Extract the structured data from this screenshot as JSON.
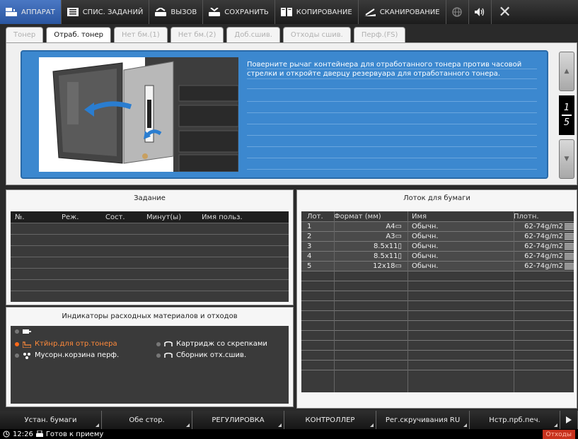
{
  "topbar": {
    "items": [
      {
        "label": "АППАРАТ",
        "icon": "machine-icon"
      },
      {
        "label": "СПИС. ЗАДАНИЙ",
        "icon": "job-list-icon"
      },
      {
        "label": "ВЫЗОВ",
        "icon": "recall-icon"
      },
      {
        "label": "СОХРАНИТЬ",
        "icon": "store-icon"
      },
      {
        "label": "КОПИРОВАНИЕ",
        "icon": "copy-icon"
      },
      {
        "label": "СКАНИРОВАНИЕ",
        "icon": "scan-icon"
      }
    ],
    "globe_icon": "globe-icon",
    "sound_icon": "speaker-icon",
    "close_label": "✕"
  },
  "tabs": [
    {
      "label": "Тонер",
      "active": false
    },
    {
      "label": "Отраб. тонер",
      "active": true
    },
    {
      "label": "Нет бм.(1)",
      "active": false
    },
    {
      "label": "Нет бм.(2)",
      "active": false
    },
    {
      "label": "Доб.сшив.",
      "active": false
    },
    {
      "label": "Отходы сшив.",
      "active": false
    },
    {
      "label": "Перф.(FS)",
      "active": false
    }
  ],
  "instruction": {
    "text": "Поверните рычаг контейнера для отработанного тонера против часовой стрелки и откройте дверцу резервуара для отработанного тонера.",
    "page_current": "1",
    "page_total": "5",
    "up_label": "▲",
    "down_label": "▼"
  },
  "job_panel": {
    "title": "Задание",
    "columns": [
      "№.",
      "Реж.",
      "Сост.",
      "Минут(ы)",
      "Имя польз."
    ]
  },
  "consumables": {
    "title": "Индикаторы расходных материалов и отходов",
    "items": [
      {
        "label": "",
        "active": false
      },
      {
        "label": "Ктйнр.для отр.тонера",
        "active": true
      },
      {
        "label": "Картридж со скрепками",
        "active": false
      },
      {
        "label": "Мусорн.корзина перф.",
        "active": false
      },
      {
        "label": "Сборник отх.сшив.",
        "active": false
      }
    ],
    "active_color": "#ff6a1a"
  },
  "tray_panel": {
    "title": "Лоток для бумаги",
    "columns": [
      "Лот.",
      "Формат (мм)",
      "Имя",
      "Плотн."
    ],
    "rows": [
      {
        "lot": "1",
        "format": "A4",
        "name": "Обычн.",
        "weight": "62-74g/m2"
      },
      {
        "lot": "2",
        "format": "A3",
        "name": "Обычн.",
        "weight": "62-74g/m2"
      },
      {
        "lot": "3",
        "format": "8.5x11",
        "name": "Обычн.",
        "weight": "62-74g/m2"
      },
      {
        "lot": "4",
        "format": "8.5x11",
        "name": "Обычн.",
        "weight": "62-74g/m2"
      },
      {
        "lot": "5",
        "format": "12x18",
        "name": "Обычн.",
        "weight": "62-74g/m2"
      }
    ]
  },
  "bottombar": [
    "Устан. бумаги",
    "Обе стор.",
    "РЕГУЛИРОВКА",
    "КОНТРОЛЛЕР",
    "Рег.скручивания RU",
    "Нстр.прб.печ."
  ],
  "status": {
    "time": "12:26",
    "message": "Готов к приему",
    "waste_badge": "Отходы"
  },
  "colors": {
    "accent_blue": "#3c88cf",
    "warning": "#c8321e"
  }
}
